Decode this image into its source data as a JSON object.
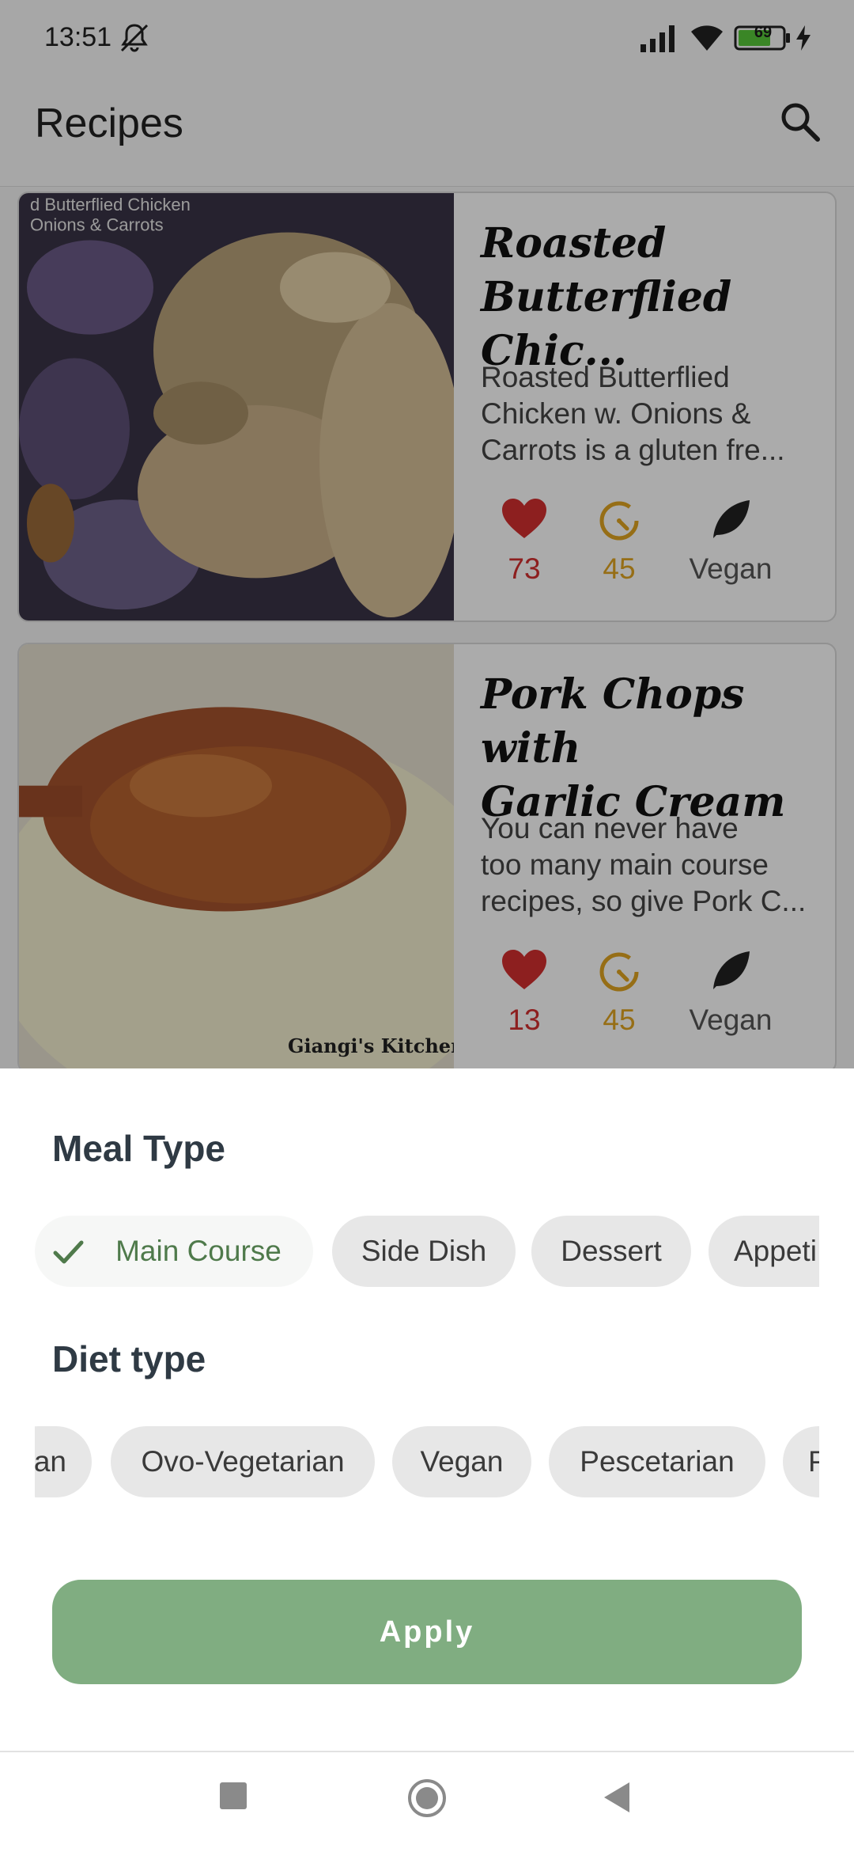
{
  "status_bar": {
    "time": "13:51",
    "battery": "69",
    "icons": [
      "mute-icon",
      "signal-icon",
      "wifi-icon",
      "battery-icon",
      "charging-icon"
    ]
  },
  "app_bar": {
    "title": "Recipes",
    "search_icon": "search-icon"
  },
  "recipes": [
    {
      "title": "Roasted\nButterflied Chic...",
      "description": "Roasted Butterflied\nChicken w. Onions &\nCarrots is a gluten fre...",
      "likes": "73",
      "minutes": "45",
      "diet": "Vegan",
      "image_caption": "d Butterflied Chicken\nOnions & Carrots"
    },
    {
      "title": "Pork Chops with\nGarlic Cream",
      "description": "You can never have\ntoo many main course\nrecipes, so give Pork C...",
      "likes": "13",
      "minutes": "45",
      "diet": "Vegan",
      "image_caption": "Giangi's Kitchen©"
    }
  ],
  "sheet": {
    "meal_type_title": "Meal Type",
    "meal_types": [
      {
        "label": "Main Course",
        "selected": true
      },
      {
        "label": "Side Dish",
        "selected": false
      },
      {
        "label": "Dessert",
        "selected": false
      },
      {
        "label": "Appeti",
        "selected": false
      }
    ],
    "diet_type_title": "Diet type",
    "diet_types": [
      {
        "label": "an",
        "selected": false
      },
      {
        "label": "Ovo-Vegetarian",
        "selected": false
      },
      {
        "label": "Vegan",
        "selected": false
      },
      {
        "label": "Pescetarian",
        "selected": false
      },
      {
        "label": "P",
        "selected": false
      }
    ],
    "apply_label": "Apply"
  },
  "colors": {
    "accent": "#80ad81",
    "selected_chip_text": "#4f7a4b",
    "likes": "#d32f2f",
    "time": "#e0a422"
  }
}
